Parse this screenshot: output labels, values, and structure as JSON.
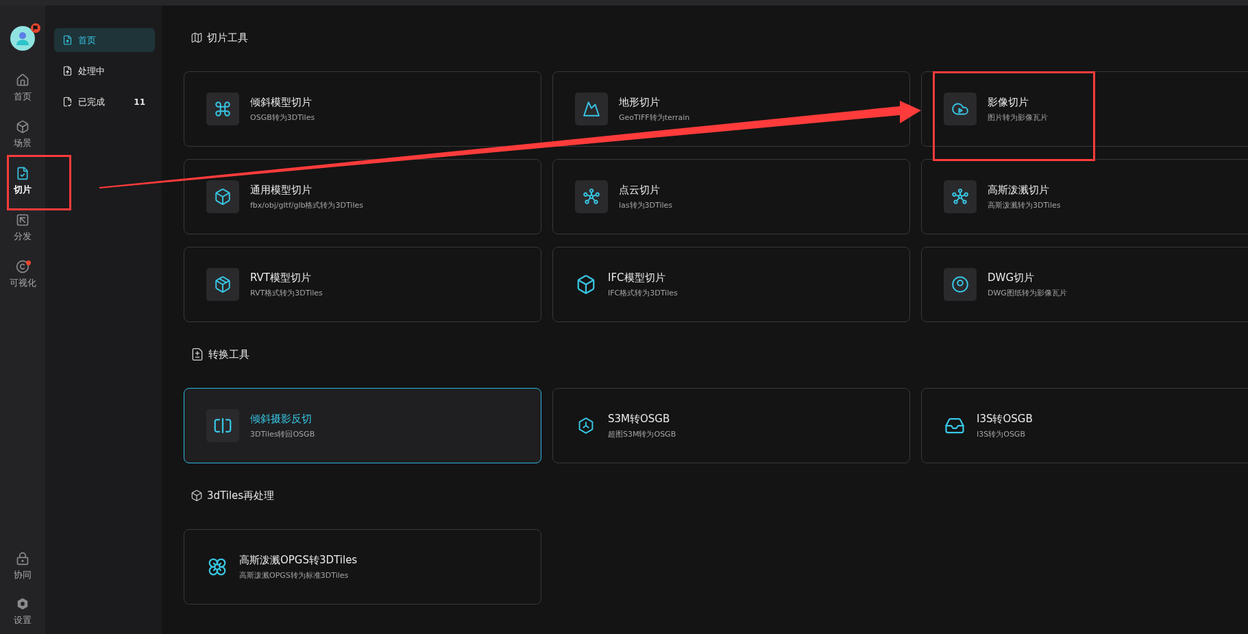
{
  "rail": {
    "items": [
      {
        "label": "首页",
        "selected": false,
        "badge": false
      },
      {
        "label": "场景",
        "selected": false,
        "badge": false
      },
      {
        "label": "切片",
        "selected": true,
        "badge": false
      },
      {
        "label": "分发",
        "selected": false,
        "badge": false
      },
      {
        "label": "可视化",
        "selected": false,
        "badge": true
      }
    ],
    "bottom_items": [
      {
        "label": "协同"
      },
      {
        "label": "设置"
      }
    ]
  },
  "subnav": [
    {
      "label": "首页",
      "selected": true
    },
    {
      "label": "处理中",
      "selected": false
    },
    {
      "label": "已完成",
      "selected": false,
      "count": "11"
    }
  ],
  "sections": [
    {
      "title": "切片工具",
      "cards": [
        {
          "title": "倾斜模型切片",
          "subtitle": "OSGB转为3DTiles",
          "tile": true,
          "selected": false
        },
        {
          "title": "地形切片",
          "subtitle": "GeoTIFF转为terrain",
          "tile": true,
          "selected": false
        },
        {
          "title": "影像切片",
          "subtitle": "图片转为影像瓦片",
          "tile": true,
          "selected": false
        },
        {
          "title": "通用模型切片",
          "subtitle": "fbx/obj/gltf/glb格式转为3DTiles",
          "tile": true,
          "selected": false
        },
        {
          "title": "点云切片",
          "subtitle": "las转为3DTiles",
          "tile": true,
          "selected": false
        },
        {
          "title": "高斯泼溅切片",
          "subtitle": "高斯泼溅转为3DTiles",
          "tile": true,
          "selected": false
        },
        {
          "title": "RVT模型切片",
          "subtitle": "RVT格式转为3DTiles",
          "tile": true,
          "selected": false
        },
        {
          "title": "IFC模型切片",
          "subtitle": "IFC格式转为3DTiles",
          "tile": false,
          "selected": false
        },
        {
          "title": "DWG切片",
          "subtitle": "DWG图纸转为影像瓦片",
          "tile": true,
          "selected": false
        }
      ]
    },
    {
      "title": "转换工具",
      "cards": [
        {
          "title": "倾斜摄影反切",
          "subtitle": "3DTiles转回OSGB",
          "tile": true,
          "selected": true
        },
        {
          "title": "S3M转OSGB",
          "subtitle": "超图S3M转为OSGB",
          "tile": false,
          "selected": false
        },
        {
          "title": "I3S转OSGB",
          "subtitle": "I3S转为OSGB",
          "tile": false,
          "selected": false
        }
      ]
    },
    {
      "title": "3dTiles再处理",
      "cards": [
        {
          "title": "高斯泼溅OPGS转3DTiles",
          "subtitle": "高斯泼溅OPGS转为标准3DTiles",
          "tile": false,
          "selected": false
        }
      ]
    }
  ]
}
